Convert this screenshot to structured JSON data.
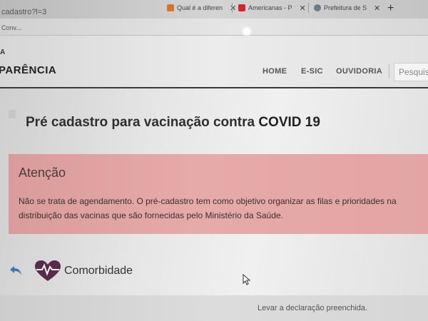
{
  "browser": {
    "url_fragment": "cadastro?l=3",
    "tabs": [
      {
        "title": "Qual é a diferen",
        "favicon_color": "#d8732f"
      },
      {
        "title": "Americanas - P",
        "favicon_color": "#d0262b"
      },
      {
        "title": "Prefeitura de S",
        "favicon_color": "#6d7a8c"
      }
    ],
    "bookmark": "Conv..."
  },
  "header": {
    "brand_top": "A",
    "brand": "PARÊNCIA",
    "nav": [
      "HOME",
      "E-SIC",
      "OUVIDORIA"
    ],
    "search_placeholder": "Pesquis"
  },
  "main": {
    "title_prefix": "Pré cadastro para vacinação contra",
    "title_bold": "COVID 19",
    "alert": {
      "title": "Atenção",
      "text": "Não se trata de agendamento. O pré-cadastro tem como objetivo organizar as filas e prioridades na distribuição das vacinas que são fornecidas pelo Ministério da Saúde.",
      "color": "#e2a5a3"
    },
    "section_label": "Comorbidade",
    "footer_note": "Levar a declaração preenchida."
  },
  "colors": {
    "accent_heart": "#5a2a4a",
    "back_arrow": "#3a78b5"
  }
}
